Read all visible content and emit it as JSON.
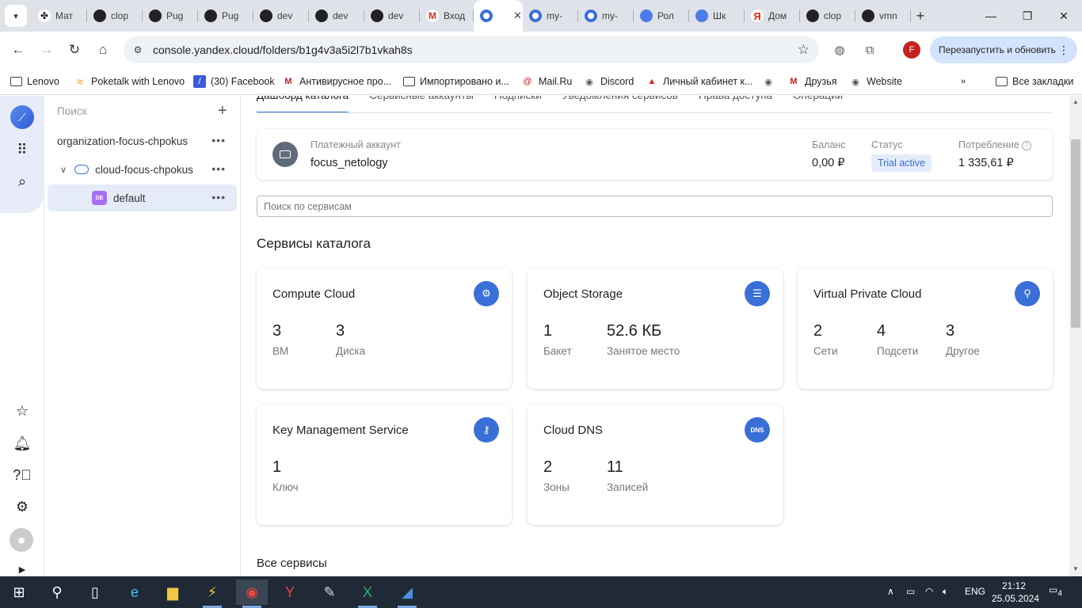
{
  "browser": {
    "tabs": [
      {
        "label": "Мат",
        "icon": "mat"
      },
      {
        "label": "clop",
        "icon": "github"
      },
      {
        "label": "Pug",
        "icon": "github"
      },
      {
        "label": "Pug",
        "icon": "github"
      },
      {
        "label": "dev",
        "icon": "github"
      },
      {
        "label": "dev",
        "icon": "github"
      },
      {
        "label": "dev",
        "icon": "github"
      },
      {
        "label": "Вход",
        "icon": "gmail"
      },
      {
        "label": "",
        "icon": "yandex-cloud",
        "active": true
      },
      {
        "label": "my-",
        "icon": "yandex-cloud"
      },
      {
        "label": "my-",
        "icon": "yandex-cloud"
      },
      {
        "label": "Рол",
        "icon": "blue-globe"
      },
      {
        "label": "Шк",
        "icon": "blue-globe"
      },
      {
        "label": "Дом",
        "icon": "yandex"
      },
      {
        "label": "clop",
        "icon": "github"
      },
      {
        "label": "vmn",
        "icon": "github"
      }
    ],
    "url": "console.yandex.cloud/folders/b1g4v3a5i2l7b1vkah8s",
    "profile_initial": "F",
    "relaunch_label": "Перезапустить и обновить",
    "bookmarks": [
      "Lenovo",
      "Poketalk with Lenovo",
      "(30) Facebook",
      "Антивирусное про...",
      "Импортировано и...",
      "Mail.Ru",
      "Discord",
      "Личный кабинет к...",
      "",
      "Друзья",
      "Website"
    ],
    "all_bookmarks": "Все закладки"
  },
  "nav": {
    "search_placeholder": "Поиск",
    "organization": "organization-focus-chpokus",
    "cloud": "cloud-focus-chpokus",
    "folder_badge": "DE",
    "folder": "default"
  },
  "main": {
    "tabs": [
      "Дашборд каталога",
      "Сервисные аккаунты",
      "Подписки",
      "Уведомления сервисов",
      "Права доступа",
      "Операции"
    ],
    "billing": {
      "account_label": "Платежный аккаунт",
      "account_name": "focus_netology",
      "balance_label": "Баланс",
      "balance_value": "0,00 ₽",
      "status_label": "Статус",
      "status_value": "Trial active",
      "consumption_label": "Потребление",
      "consumption_value": "1 335,61 ₽"
    },
    "service_search_placeholder": "Поиск по сервисам",
    "catalog_title": "Сервисы каталога",
    "all_services_title": "Все сервисы",
    "cards": [
      {
        "title": "Compute Cloud",
        "icon": "gear-icon",
        "metrics": [
          {
            "value": "3",
            "label": "ВМ"
          },
          {
            "value": "3",
            "label": "Диска"
          }
        ]
      },
      {
        "title": "Object Storage",
        "icon": "storage-icon",
        "metrics": [
          {
            "value": "1",
            "label": "Бакет"
          },
          {
            "value": "52.6 КБ",
            "label": "Занятое место"
          }
        ]
      },
      {
        "title": "Virtual Private Cloud",
        "icon": "network-icon",
        "metrics": [
          {
            "value": "2",
            "label": "Сети"
          },
          {
            "value": "4",
            "label": "Подсети"
          },
          {
            "value": "3",
            "label": "Другое"
          }
        ]
      },
      {
        "title": "Key Management Service",
        "icon": "key-icon",
        "metrics": [
          {
            "value": "1",
            "label": "Ключ"
          }
        ]
      },
      {
        "title": "Cloud DNS",
        "icon": "dns-icon",
        "icon_text": "DNS",
        "metrics": [
          {
            "value": "2",
            "label": "Зоны"
          },
          {
            "value": "11",
            "label": "Записей"
          }
        ]
      }
    ]
  },
  "taskbar": {
    "language": "ENG",
    "time": "21:12",
    "date": "25.05.2024",
    "notifications": "4"
  }
}
